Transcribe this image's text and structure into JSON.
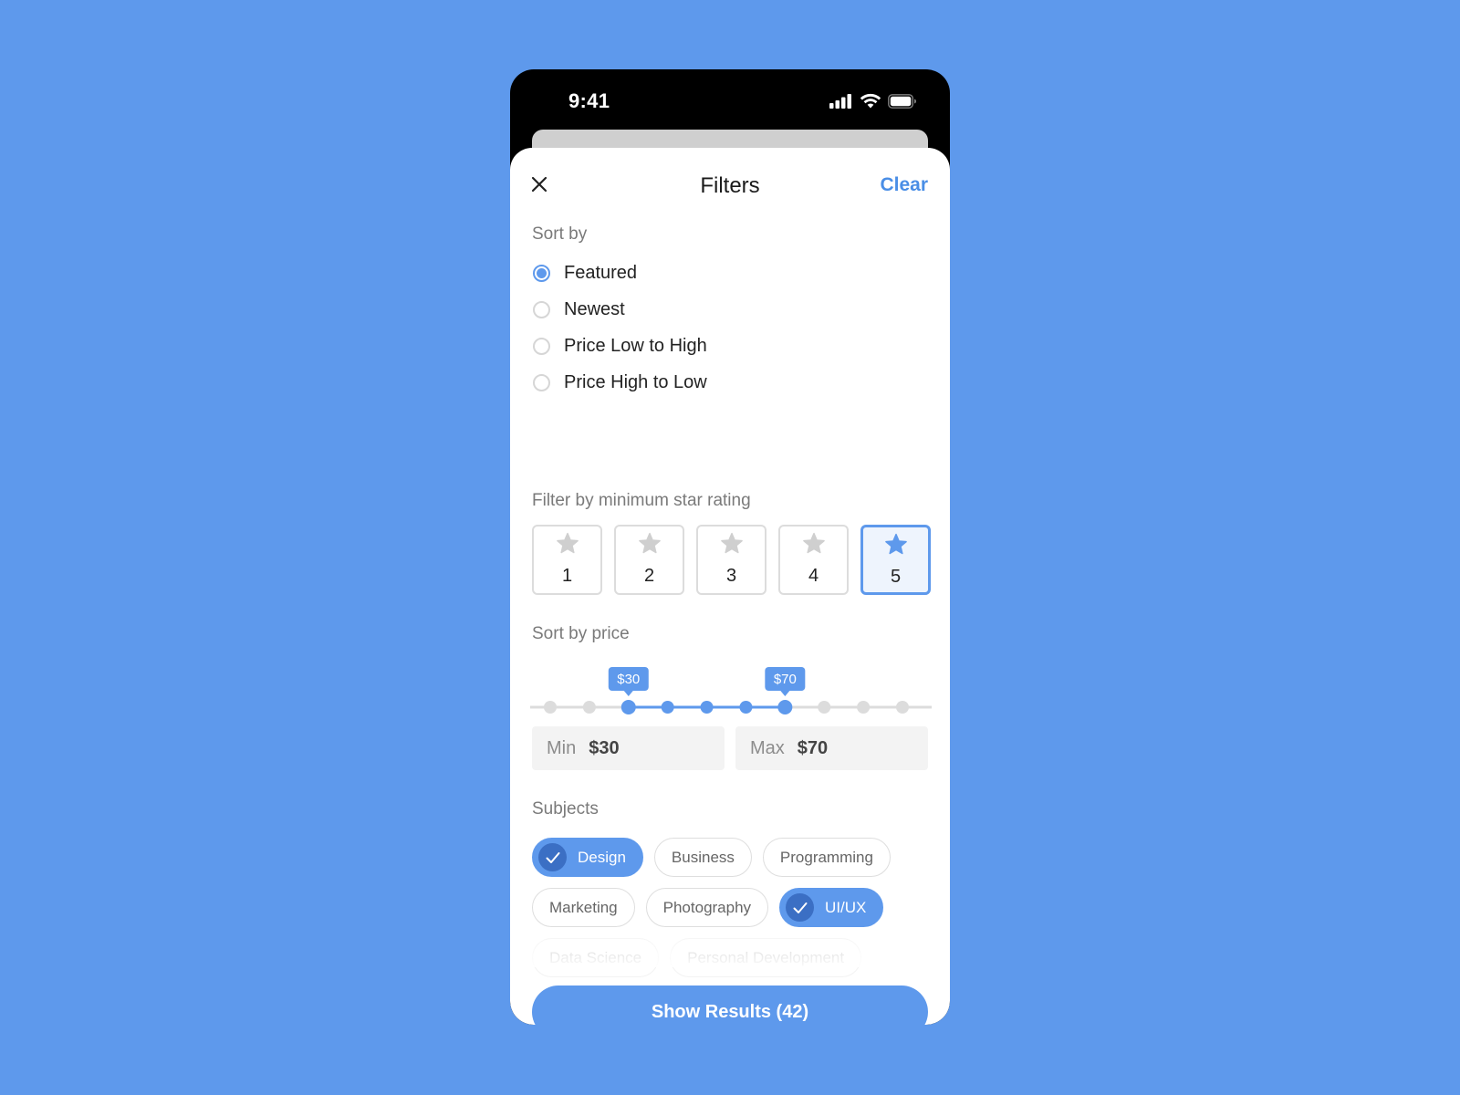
{
  "status_bar": {
    "time": "9:41"
  },
  "header": {
    "title": "Filters",
    "clear_label": "Clear"
  },
  "sort_by": {
    "label": "Sort by",
    "options": [
      {
        "label": "Featured",
        "selected": true
      },
      {
        "label": "Newest",
        "selected": false
      },
      {
        "label": "Price Low to High",
        "selected": false
      },
      {
        "label": "Price High to Low",
        "selected": false
      }
    ]
  },
  "star_rating": {
    "label": "Filter by minimum star rating",
    "options": [
      "1",
      "2",
      "3",
      "4",
      "5"
    ],
    "selected": "5"
  },
  "price": {
    "label": "Sort by price",
    "steps": 10,
    "range_start_index": 2,
    "range_end_index": 6,
    "min_tooltip": "$30",
    "max_tooltip": "$70",
    "min_label": "Min",
    "min_value": "$30",
    "max_label": "Max",
    "max_value": "$70"
  },
  "subjects": {
    "label": "Subjects",
    "rows": [
      [
        {
          "label": "Design",
          "selected": true
        },
        {
          "label": "Business",
          "selected": false
        },
        {
          "label": "Programming",
          "selected": false
        }
      ],
      [
        {
          "label": "Marketing",
          "selected": false
        },
        {
          "label": "Photography",
          "selected": false
        },
        {
          "label": "UI/UX",
          "selected": true
        }
      ],
      [
        {
          "label": "Data Science",
          "selected": false
        },
        {
          "label": "Personal Development",
          "selected": false
        }
      ]
    ]
  },
  "show_results_label": "Show Results (42)",
  "colors": {
    "background": "#5e99ec",
    "accent": "#5e99ec",
    "accent_dark": "#3b6fc4",
    "track_inactive": "#dcdcdc"
  }
}
